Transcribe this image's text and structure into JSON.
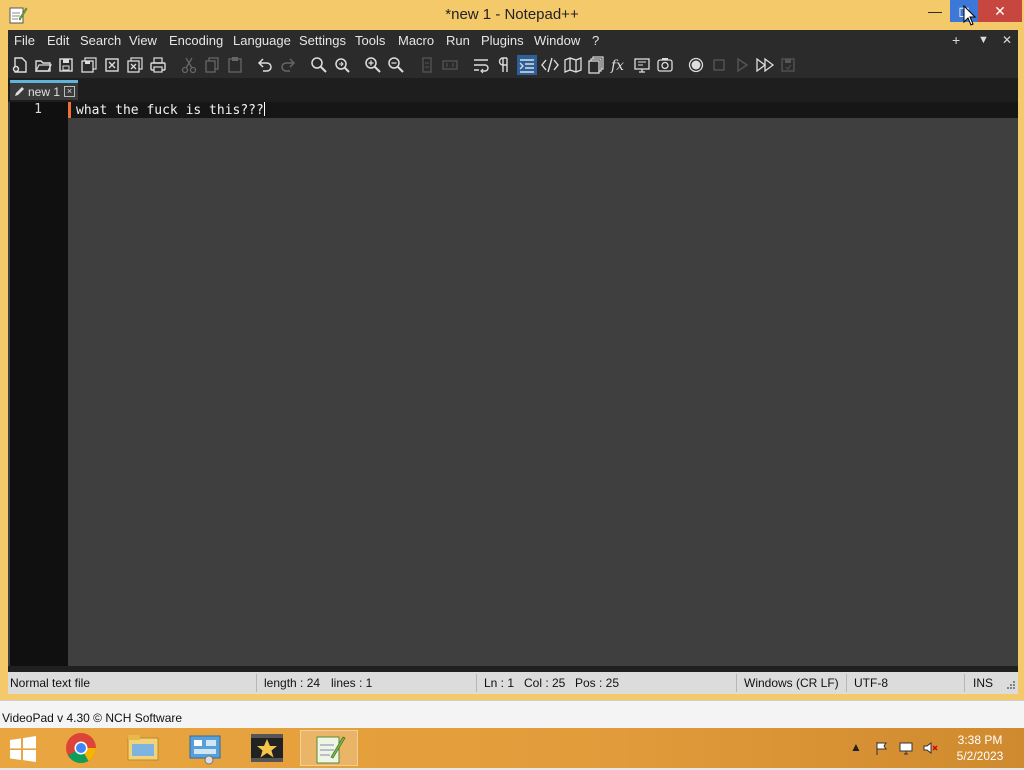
{
  "window": {
    "title": "*new 1 - Notepad++",
    "controls": {
      "minimize": "—",
      "maximize": "◻",
      "close": "✕"
    }
  },
  "menu": {
    "items": [
      "File",
      "Edit",
      "Search",
      "View",
      "Encoding",
      "Language",
      "Settings",
      "Tools",
      "Macro",
      "Run",
      "Plugins",
      "Window",
      "?"
    ],
    "right": {
      "add": "+",
      "dropdown": "▼",
      "close": "✕"
    }
  },
  "toolbar": {
    "icons": [
      "new-file-icon",
      "open-file-icon",
      "save-icon",
      "save-all-icon",
      "close-icon",
      "close-all-icon",
      "print-icon",
      "cut-icon",
      "copy-icon",
      "paste-icon",
      "undo-icon",
      "redo-icon",
      "find-icon",
      "replace-icon",
      "zoom-in-icon",
      "zoom-out-icon",
      "sync-vertical-icon",
      "sync-horizontal-icon",
      "word-wrap-icon",
      "show-all-chars-icon",
      "indent-guide-icon",
      "language-markup-icon",
      "document-map-icon",
      "document-list-icon",
      "function-list-icon",
      "folder-workspace-icon",
      "monitoring-icon",
      "record-macro-icon",
      "stop-record-icon",
      "play-macro-icon",
      "run-macro-multiple-icon",
      "save-macro-icon"
    ]
  },
  "tabs": [
    {
      "label": "new 1",
      "modified": true,
      "close": "×"
    }
  ],
  "editor": {
    "lines": [
      {
        "number": "1",
        "text": "what the fuck is this???"
      }
    ]
  },
  "status": {
    "file_type": "Normal text file",
    "length": "length : 24",
    "lines": "lines : 1",
    "ln": "Ln : 1",
    "col": "Col : 25",
    "pos": "Pos : 25",
    "eol": "Windows (CR LF)",
    "encoding": "UTF-8",
    "mode": "INS"
  },
  "background_app": {
    "text": "VideoPad v 4.30 © NCH Software"
  },
  "taskbar": {
    "apps": [
      "chrome-icon",
      "file-explorer-icon",
      "control-panel-icon",
      "movie-maker-icon",
      "notepad-plus-plus-icon"
    ],
    "active_app": "notepad-plus-plus-icon",
    "clock": {
      "time": "3:38 PM",
      "date": "5/2/2023"
    },
    "tray": {
      "show_hidden": "▲"
    }
  },
  "colors": {
    "title_bar": "#f4c96a",
    "editor_bg": "#3f3f3f",
    "gutter_bg": "#101010",
    "current_line_marker": "#f07030",
    "taskbar": "#e29b3a"
  }
}
